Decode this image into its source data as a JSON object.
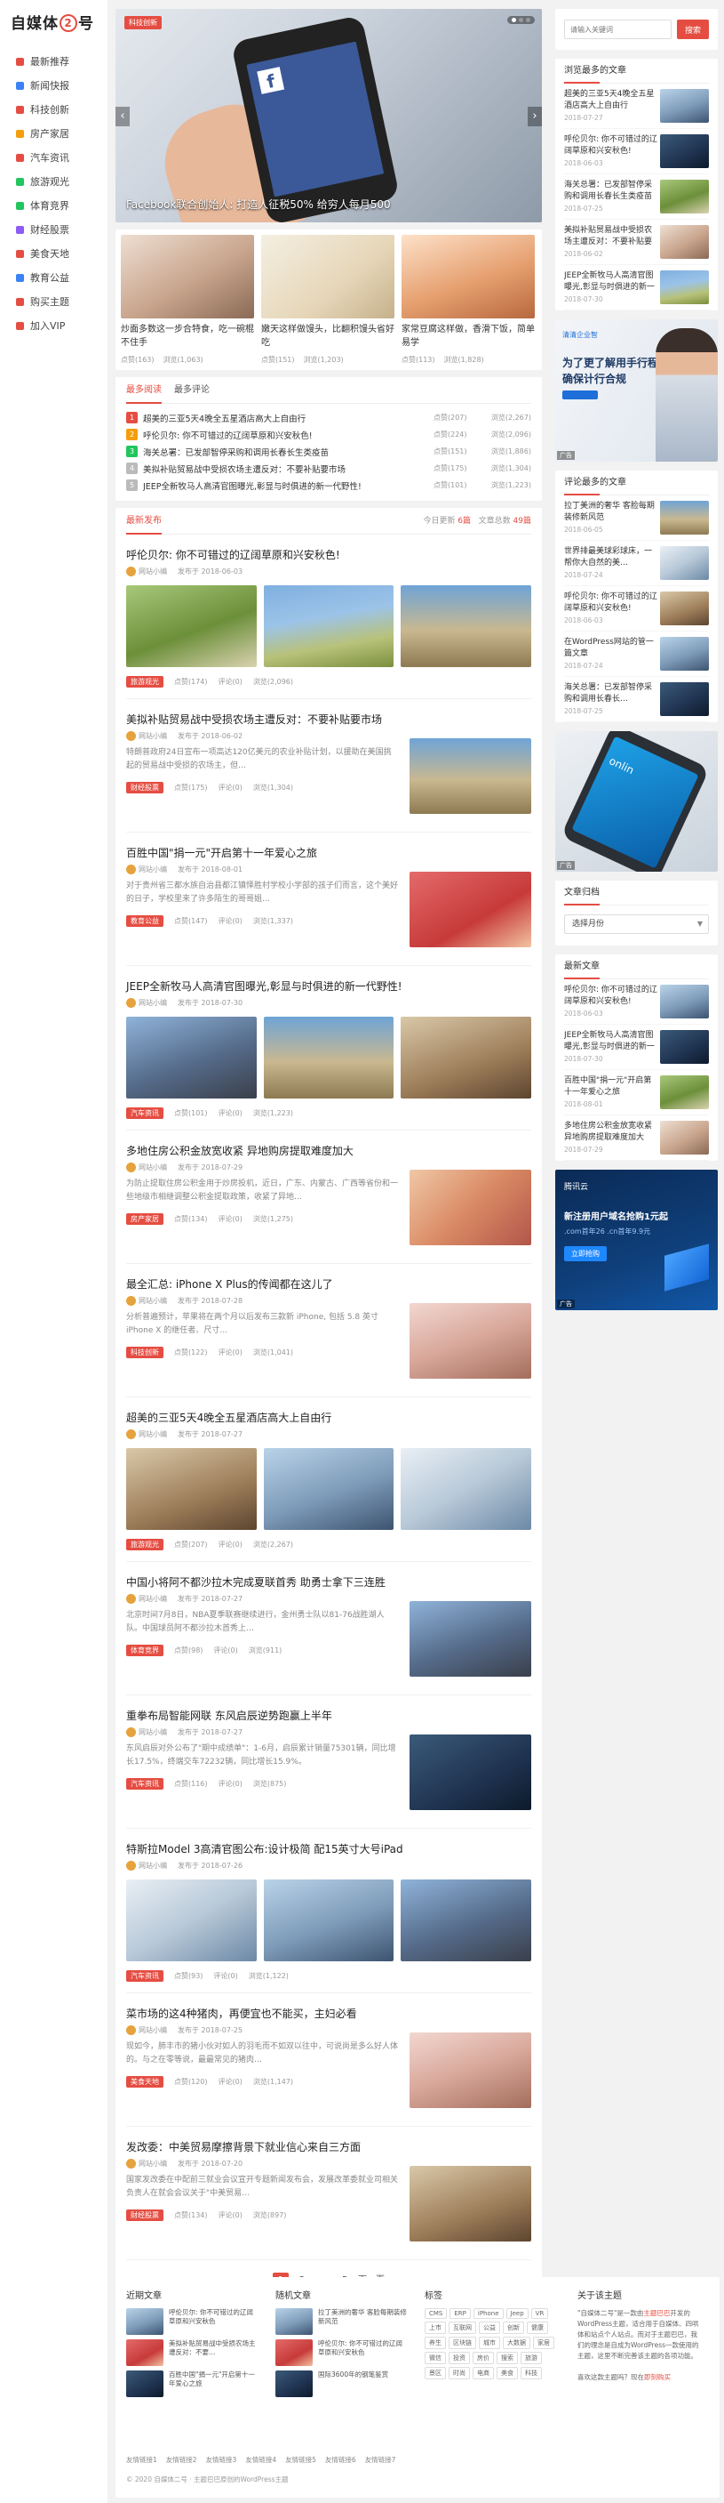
{
  "site": {
    "logo_left": "自媒体",
    "logo_num": "2",
    "logo_right": "号"
  },
  "nav": [
    {
      "label": "最新推荐",
      "color": "#e54d42"
    },
    {
      "label": "新闻快报",
      "color": "#3b82f6"
    },
    {
      "label": "科技创新",
      "color": "#e54d42"
    },
    {
      "label": "房产家居",
      "color": "#f59e0b"
    },
    {
      "label": "汽车资讯",
      "color": "#e54d42"
    },
    {
      "label": "旅游观光",
      "color": "#22c55e"
    },
    {
      "label": "体育竞界",
      "color": "#22c55e"
    },
    {
      "label": "财经股票",
      "color": "#8b5cf6"
    },
    {
      "label": "美食天地",
      "color": "#e54d42"
    },
    {
      "label": "教育公益",
      "color": "#3b82f6"
    },
    {
      "label": "购买主题",
      "color": "#e54d42"
    },
    {
      "label": "加入VIP",
      "color": "#e54d42"
    }
  ],
  "slider": {
    "tag": "科技创新",
    "caption": "Facebook联合创始人: 打造人征税50% 给穷人每月500",
    "brand": "f",
    "brand_name": "Facebook",
    "prev": "‹",
    "next": "›"
  },
  "cards": [
    {
      "title": "炒面多数这一步合特食，吃一碗棍不住手",
      "views": "点赞(163)",
      "comments": "浏览(1,063)"
    },
    {
      "title": "嫩天这样做馒头，比翻积馒头省好吃",
      "views": "点赞(151)",
      "comments": "浏览(1,203)"
    },
    {
      "title": "家常豆腐这样做，香滑下饭，简单易学",
      "views": "点赞(113)",
      "comments": "浏览(1,828)"
    }
  ],
  "hot": {
    "tab_active": "最多阅读",
    "tab_other": "最多评论",
    "items": [
      {
        "n": "1",
        "title": "超美的三亚5天4晚全五星酒店高大上自由行",
        "views": "点赞(207)",
        "likes": "浏览(2,267)",
        "color": "#e54d42"
      },
      {
        "n": "2",
        "title": "呼伦贝尔: 你不可错过的辽阔草原和兴安秋色!",
        "views": "点赞(224)",
        "likes": "浏览(2,096)",
        "color": "#f59e0b"
      },
      {
        "n": "3",
        "title": "海关总署：已发部智停采购和调用长春长生类疫苗",
        "views": "点赞(151)",
        "likes": "浏览(1,886)",
        "color": "#22c55e"
      },
      {
        "n": "4",
        "title": "美拟补贴贸易战中受损农场主遭反对：不要补贴要市场",
        "views": "点赞(175)",
        "likes": "浏览(1,304)",
        "color": "#bbb"
      },
      {
        "n": "5",
        "title": "JEEP全新牧马人高清官图曝光,彰显与时俱进的新一代野性!",
        "views": "点赞(101)",
        "likes": "浏览(1,223)",
        "color": "#bbb"
      }
    ]
  },
  "feed": {
    "tab": "最新发布",
    "right_prefix": "今日更新",
    "today": "6篇",
    "right_mid": "文章总数",
    "total": "49篇",
    "posts": [
      {
        "kind": "triple",
        "title": "呼伦贝尔: 你不可错过的辽阔草原和兴安秋色!",
        "author": "网站小编",
        "date": "发布于 2018-06-03",
        "cat": "旅游观光",
        "likes": "点赞(174)",
        "comments": "评论(0)",
        "views": "浏览(2,096)"
      },
      {
        "kind": "side",
        "title": "美拟补贴贸易战中受损农场主遭反对：不要补贴要市场",
        "author": "网站小编",
        "date": "发布于 2018-06-02",
        "excerpt": "特朗普政府24日宣布一项高达120亿美元的农业补贴计划，以援助在美国挑起的贸易战中受损的农场主，但…",
        "cat": "财经股票",
        "likes": "点赞(175)",
        "comments": "评论(0)",
        "views": "浏览(1,304)"
      },
      {
        "kind": "side",
        "title": "百胜中国\"捐一元\"开启第十一年爱心之旅",
        "author": "网站小编",
        "date": "发布于 2018-08-01",
        "excerpt": "对于贵州省三都水族自治县都江镇怿胜村学校小学部的孩子们而言，这个美好的日子，学校里来了许多陌生的哥哥姐…",
        "cat": "教育公益",
        "likes": "点赞(147)",
        "comments": "评论(0)",
        "views": "浏览(1,337)"
      },
      {
        "kind": "triple",
        "title": "JEEP全新牧马人高清官图曝光,彰显与时俱进的新一代野性!",
        "author": "网站小编",
        "date": "发布于 2018-07-30",
        "cat": "汽车资讯",
        "likes": "点赞(101)",
        "comments": "评论(0)",
        "views": "浏览(1,223)"
      },
      {
        "kind": "side",
        "title": "多地住房公积金放宽收紧 异地购房提取难度加大",
        "author": "网站小编",
        "date": "发布于 2018-07-29",
        "excerpt": "为防止提取住房公积金用于炒房投机，近日，广东、内蒙古、广西等省份和一些地级市相继调整公积金提取政策，收紧了异地…",
        "cat": "房产家居",
        "likes": "点赞(134)",
        "comments": "评论(0)",
        "views": "浏览(1,275)"
      },
      {
        "kind": "side",
        "title": "最全汇总: iPhone X Plus的传闻都在这儿了",
        "author": "网站小编",
        "date": "发布于 2018-07-28",
        "excerpt": "分析普遍预计，苹果将在两个月以后发布三款新 iPhone, 包括 5.8 英寸 iPhone X 的继任者、尺寸…",
        "cat": "科技创新",
        "likes": "点赞(122)",
        "comments": "评论(0)",
        "views": "浏览(1,041)"
      },
      {
        "kind": "triple",
        "title": "超美的三亚5天4晚全五星酒店高大上自由行",
        "author": "网站小编",
        "date": "发布于 2018-07-27",
        "cat": "旅游观光",
        "likes": "点赞(207)",
        "comments": "评论(0)",
        "views": "浏览(2,267)"
      },
      {
        "kind": "side",
        "title": "中国小将阿不都沙拉木完成夏联首秀 助勇士拿下三连胜",
        "author": "网站小编",
        "date": "发布于 2018-07-27",
        "excerpt": "北京时间7月8日，NBA夏季联赛继续进行，金州勇士队以81-76战胜湖人队。中国球员阿不都沙拉木首秀上…",
        "cat": "体育竞界",
        "likes": "点赞(98)",
        "comments": "评论(0)",
        "views": "浏览(911)"
      },
      {
        "kind": "side",
        "title": "重拳布局智能网联 东风启辰逆势跑赢上半年",
        "author": "网站小编",
        "date": "发布于 2018-07-27",
        "excerpt": "东风启辰对外公布了\"期中成绩单\"：1-6月，启辰累计销量75301辆，同比增长17.5%，终端交车72232辆，同比增长15.9%。",
        "cat": "汽车资讯",
        "likes": "点赞(116)",
        "comments": "评论(0)",
        "views": "浏览(875)"
      },
      {
        "kind": "triple",
        "title": "特斯拉Model 3高清官图公布:设计极简 配15英寸大号iPad",
        "author": "网站小编",
        "date": "发布于 2018-07-26",
        "cat": "汽车资讯",
        "likes": "点赞(93)",
        "comments": "评论(0)",
        "views": "浏览(1,122)"
      },
      {
        "kind": "side",
        "title": "菜市场的这4种猪肉，再便宜也不能买，主妇必看",
        "author": "网站小编",
        "date": "发布于 2018-07-25",
        "excerpt": "现如今，肺丰市的猪小伙对如人的羽毛而不如双以往中，可说尚是多么好人体的。与之在零等说，最最常见的猪肉…",
        "cat": "美食天地",
        "likes": "点赞(120)",
        "comments": "评论(0)",
        "views": "浏览(1,147)"
      },
      {
        "kind": "side",
        "title": "发改委：中美贸易摩擦背景下就业信心来自三方面",
        "author": "网站小编",
        "date": "发布于 2018-07-20",
        "excerpt": "国家发改委在中配前三就业会议宣开专题新闻发布会，发展改革委就业司相关负责人在就会会议关于\"中美贸易…",
        "cat": "财经股票",
        "likes": "点赞(134)",
        "comments": "评论(0)",
        "views": "浏览(897)"
      }
    ]
  },
  "pager": [
    "1",
    "2",
    "...",
    "5",
    "下一页"
  ],
  "sidebar": {
    "search_placeholder": "请输入关键词",
    "search_button": "搜索",
    "viewed_title": "浏览最多的文章",
    "viewed": [
      {
        "title": "超美的三亚5天4晚全五星酒店高大上自由行",
        "date": "2018-07-27"
      },
      {
        "title": "呼伦贝尔: 你不可错过的辽阔草原和兴安秋色!",
        "date": "2018-06-03"
      },
      {
        "title": "海关总署：已发部智停采购和调用长春长生类疫苗",
        "date": "2018-07-25"
      },
      {
        "title": "美拟补贴贸易战中受损农场主遭反对：不要补贴要市场",
        "date": "2018-06-02"
      },
      {
        "title": "JEEP全新牧马人高清官图曝光,彰显与时俱进的新一代野性!",
        "date": "2018-07-30"
      }
    ],
    "ad1": {
      "brand": "清清企业智",
      "line1": "为了更了解用手行程",
      "line2": "确保计行合规",
      "tag": "广告"
    },
    "commented_title": "评论最多的文章",
    "commented": [
      {
        "title": "拉丁美洲的奢华 客脸每期装修新风范",
        "date": "2018-06-05"
      },
      {
        "title": "世界排最美球彩球床，一帮你大自然的美…",
        "date": "2018-07-24"
      },
      {
        "title": "呼伦贝尔: 你不可错过的辽阔草原和兴安秋色!",
        "date": "2018-06-03"
      },
      {
        "title": "在WordPress网站的管一篇文章",
        "date": "2018-07-24"
      },
      {
        "title": "海关总署：已发部智停采购和调用长春长…",
        "date": "2018-07-25"
      }
    ],
    "ad2": {
      "tag": "广告",
      "screen": "onlin"
    },
    "archive_title": "文章归档",
    "archive_select": "选择月份",
    "latest_title": "最新文章",
    "latest": [
      {
        "title": "呼伦贝尔: 你不可错过的辽阔草原和兴安秋色!",
        "date": "2018-06-03"
      },
      {
        "title": "JEEP全新牧马人高清官图曝光,彰显与时俱进的新一代野性!",
        "date": "2018-07-30"
      },
      {
        "title": "百胜中国\"捐一元\"开启第十一年爱心之旅",
        "date": "2018-08-01"
      },
      {
        "title": "多地住房公积金放宽收紧 异地购房提取难度加大",
        "date": "2018-07-29"
      }
    ],
    "ad3": {
      "brand": "腾讯云",
      "line1": "新注册用户域名抢购1元起",
      "line2": ".com首年26 .cn首年9.9元",
      "button": "立即抢购",
      "tag": "广告"
    }
  },
  "footer": {
    "recent_title": "近期文章",
    "recent": [
      "呼伦贝尔: 你不可错过的辽阔草原和兴安秋色",
      "美拟补贴贸易战中受损农场主遭反对：不要…",
      "百胜中国\"捐一元\"开启第十一年爱心之旅"
    ],
    "random_title": "随机文章",
    "random": [
      "拉丁美洲的奢华 客脸每期装修新风范",
      "呼伦贝尔: 你不可错过的辽阔草原和兴安秋色",
      "国际3600年的钢笔鉴赏"
    ],
    "tags_title": "标签",
    "tags": [
      "CMS",
      "ERP",
      "iPhone",
      "Jeep",
      "VR",
      "上市",
      "互联网",
      "公益",
      "创新",
      "健康",
      "养生",
      "区块链",
      "城市",
      "大数据",
      "家居",
      "微信",
      "投资",
      "房价",
      "搜索",
      "旅游",
      "景区",
      "时尚",
      "电商",
      "美食",
      "科技"
    ],
    "about_title": "关于该主题",
    "about_lead": "\"自媒体二号\"是一款由",
    "about_link": "主题巴巴",
    "about_rest": "开发的WordPress主题，适合用于自媒体、四哄体和站点个人站点。而对于主题巴巴，我们的理念是自成为WordPress一款使用的主题，这里不断完善该主题的各项功能。",
    "about_more": "喜欢这款主题吗？现在",
    "about_buy": "即刻购买",
    "links": [
      "友情链接1",
      "友情链接2",
      "友情链接3",
      "友情链接4",
      "友情链接5",
      "友情链接6",
      "友情链接7"
    ],
    "copyright": "© 2020 自媒体二号 · 主题巴巴原创的WordPress主题"
  }
}
